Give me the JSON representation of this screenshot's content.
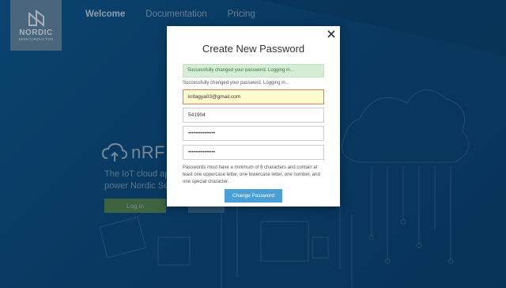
{
  "brand": {
    "name": "NORDIC",
    "subtitle": "SEMICONDUCTOR"
  },
  "nav": {
    "items": [
      {
        "label": "Welcome",
        "active": true
      },
      {
        "label": "Documentation",
        "active": false
      },
      {
        "label": "Pricing",
        "active": false
      }
    ]
  },
  "hero": {
    "title": "nRF",
    "subtitle_lines": [
      "The IoT cloud ap",
      "power Nordic Sem"
    ],
    "login_label": "Log in"
  },
  "modal": {
    "title": "Create New Password",
    "alert": "Successfully changed your password. Logging in...",
    "status": "Successfully changed your password. Logging in...",
    "email_value": "kritagya03@gmail.com",
    "code_value": "541904",
    "password_value": "•••••••••••••••",
    "confirm_value": "•••••••••••••••",
    "help": "Passwords must have a minimum of 8 characters and contain at least one uppercase letter, one lowercase letter, one number, and one special character.",
    "submit_label": "Change Password"
  },
  "colors": {
    "background": "#0b4a7c",
    "accent": "#4a9fd6",
    "alert_bg": "#d5ecd5",
    "alert_text": "#3c763d",
    "email_bg": "#fffbd0"
  },
  "icons": {
    "close": "close-icon",
    "cloud": "cloud-icon",
    "logo": "nordic-logo-icon"
  }
}
